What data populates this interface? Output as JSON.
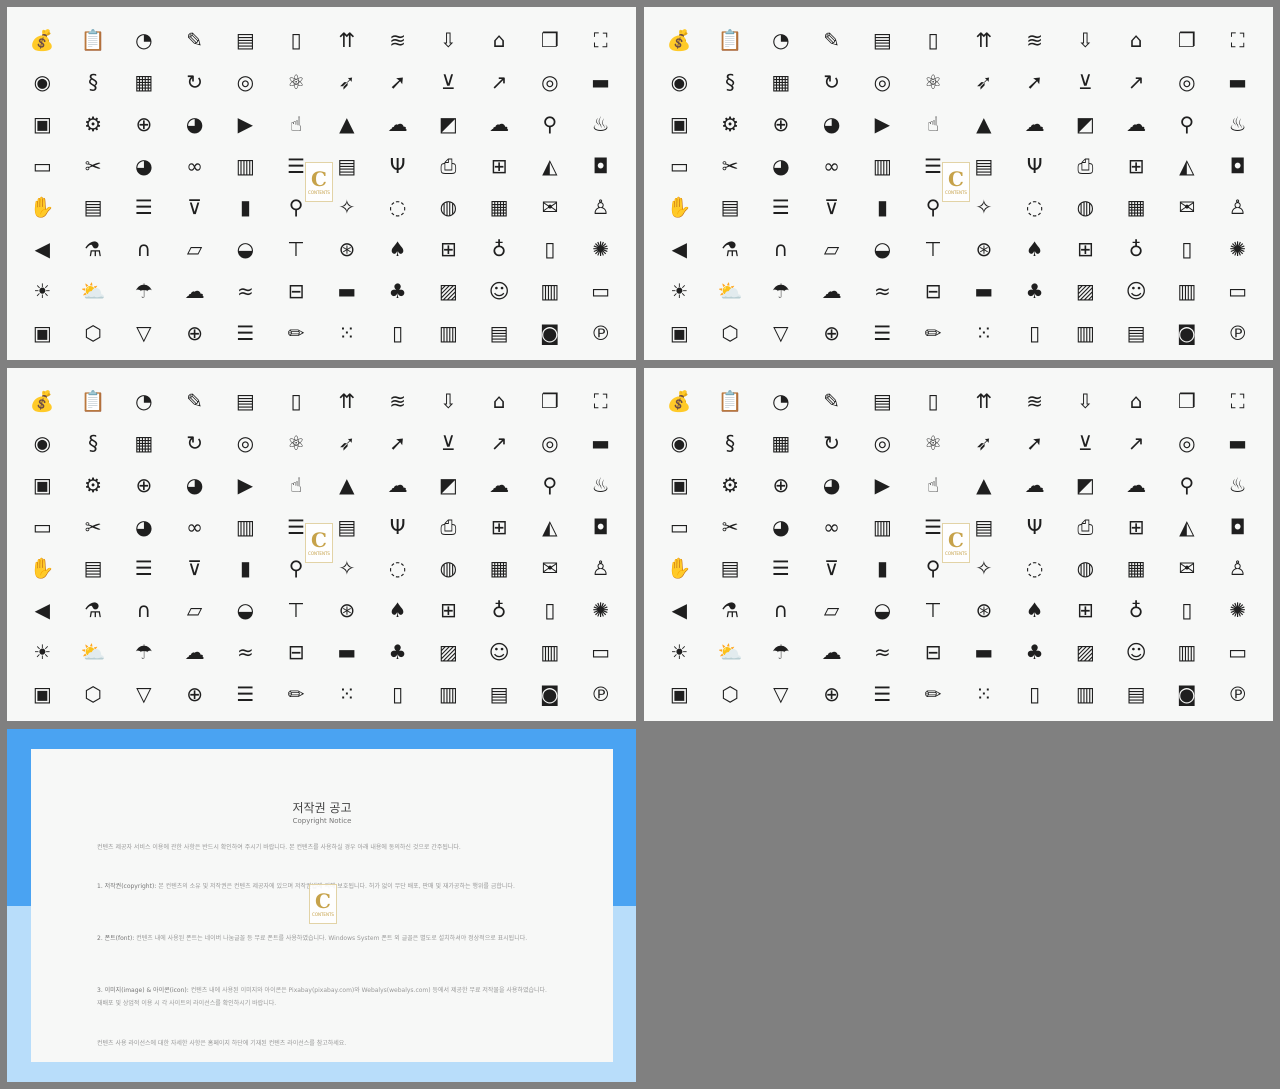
{
  "icon_sets": [
    {
      "rows": [
        [
          "money-bag-icon",
          "clipboard-check-icon",
          "speed-gauge-icon",
          "edit-note-icon",
          "cash-register-icon",
          "document-icon",
          "people-growth-icon",
          "layers-icon",
          "archive-download-icon",
          "home-icon",
          "copy-pages-icon",
          "fullscreen-icon"
        ],
        [
          "globe-icon",
          "scroll-icon",
          "office-building-icon",
          "refresh-icon",
          "cursor-click-icon",
          "atom-icon",
          "rocket-icon",
          "pointer-arrow-icon",
          "cart-download-icon",
          "growth-chart-icon",
          "target-icon",
          "hard-drive-icon"
        ],
        [
          "clipboard-task-icon",
          "gears-icon",
          "zoom-in-icon",
          "pie-outline-icon",
          "video-player-icon",
          "hand-pointer-icon",
          "tree-icon",
          "cloud-check-icon",
          "presentation-icon",
          "cloud-icon",
          "location-user-icon",
          "campfire-icon"
        ],
        [
          "wallet-icon",
          "tools-icon",
          "pie-chart-icon",
          "link-icon",
          "trash-icon",
          "sliders-icon",
          "certificate-icon",
          "usb-icon",
          "printer-icon",
          "add-document-icon",
          "satellite-dish-icon",
          "overlap-squares-icon"
        ],
        [
          "hand-icon",
          "id-card-icon",
          "list-icon",
          "shopping-cart-icon",
          "notebook-icon",
          "map-pin-icon",
          "magic-wand-icon",
          "chat-bubble-icon",
          "palette-icon",
          "chart-board-icon",
          "envelope-icon",
          "user-icon"
        ],
        [
          "megaphone-icon",
          "flask-icon",
          "magnet-icon",
          "folder-icon",
          "speech-bubbles-icon",
          "signpost-icon",
          "team-target-icon",
          "thumbs-up-icon",
          "gift-icon",
          "light-bulb-icon",
          "smartphone-icon",
          "paint-palette-icon"
        ],
        [
          "sun-icon",
          "partly-cloudy-icon",
          "rain-cloud-icon",
          "cloud-outline-icon",
          "windy-icon",
          "battery-charging-icon",
          "battery-icon",
          "tree-cloud-icon",
          "image-icon",
          "smiley-icon",
          "trash-can-icon",
          "credit-card-icon"
        ],
        [
          "film-strip-icon",
          "package-icon",
          "coffee-cup-icon",
          "shield-plus-icon",
          "bullet-list-icon",
          "pencil-icon",
          "grid-dots-icon",
          "mobile-touch-icon",
          "map-icon",
          "newspaper-icon",
          "instagram-icon",
          "pinterest-icon"
        ]
      ]
    }
  ],
  "watermark": {
    "mark": "C",
    "text": "CONTENTS"
  },
  "notice": {
    "title": "저작권 공고",
    "subtitle": "Copyright Notice",
    "intro": "컨텐츠 제공자 서비스 이용에 관한 사항은 반드시 확인하여 주시기 바랍니다. 본 컨텐츠를 사용하실 경우 아래 내용에 동의하신 것으로 간주됩니다.",
    "items": [
      {
        "heading": "1. 저작권(copyright):",
        "text": "본 컨텐츠의 소유 및 저작권은 컨텐츠 제공자에 있으며 저작권법에 의해 보호됩니다. 허가 없이 무단 배포, 판매 및 재가공하는 행위를 금합니다."
      },
      {
        "heading": "2. 폰트(font):",
        "text": "컨텐츠 내에 사용된 폰트는 네이버 나눔글꼴 등 무료 폰트를 사용하였습니다. Windows System 폰트 외 글꼴은 별도로 설치하셔야 정상적으로 표시됩니다."
      },
      {
        "heading": "3. 이미지(image) & 아이콘(icon):",
        "text": "컨텐츠 내에 사용된 이미지와 아이콘은 Pixabay(pixabay.com)와 Webalys(webalys.com) 등에서 제공한 무료 저작물을 사용하였습니다. 재배포 및 상업적 이용 시 각 사이트의 라이선스를 확인하시기 바랍니다."
      }
    ],
    "footer": "컨텐츠 사용 라이선스에 대한 자세한 사항은 홈페이지 하단에 기재된 컨텐츠 라이선스를 참고하세요."
  }
}
